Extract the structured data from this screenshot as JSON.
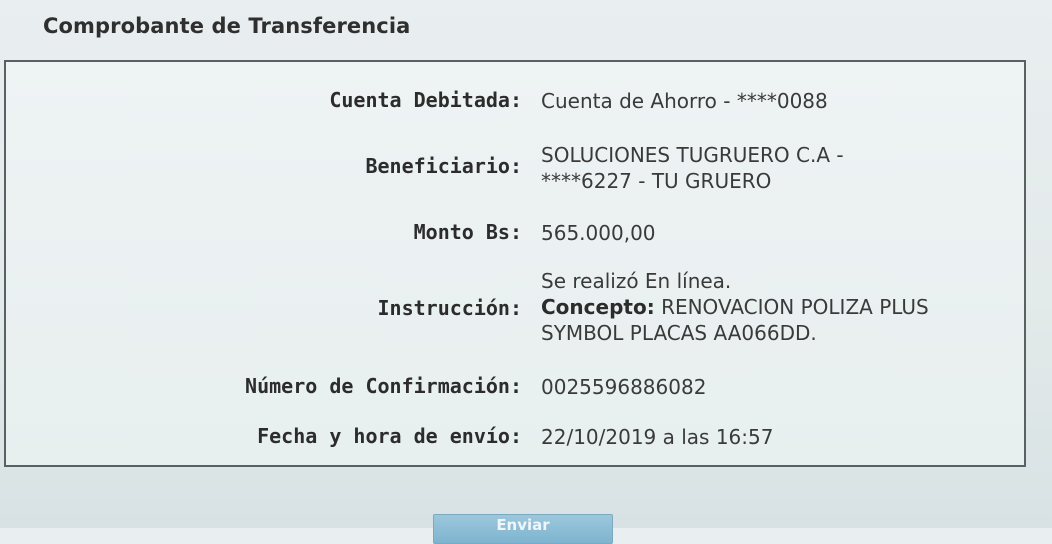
{
  "page": {
    "title": "Comprobante de Transferencia"
  },
  "receipt": {
    "cuenta_debitada": {
      "label": "Cuenta Debitada:",
      "value": "Cuenta de Ahorro - ****0088"
    },
    "beneficiario": {
      "label": "Beneficiario:",
      "value_line1": "SOLUCIONES TUGRUERO C.A -",
      "value_line2": "****6227 - TU GRUERO"
    },
    "monto": {
      "label": "Monto Bs:",
      "value": "565.000,00"
    },
    "instruccion": {
      "label": "Instrucción:",
      "line1": "Se realizó En línea.",
      "concepto_label": "Concepto:",
      "concepto_value_line1": "RENOVACION POLIZA PLUS",
      "concepto_value_line2": "SYMBOL PLACAS AA066DD."
    },
    "confirmacion": {
      "label": "Número de Confirmación:",
      "value": "0025596886082"
    },
    "fecha": {
      "label": "Fecha y hora de envío:",
      "value": "22/10/2019 a las 16:57"
    }
  },
  "actions": {
    "send_label": "Enviar"
  }
}
